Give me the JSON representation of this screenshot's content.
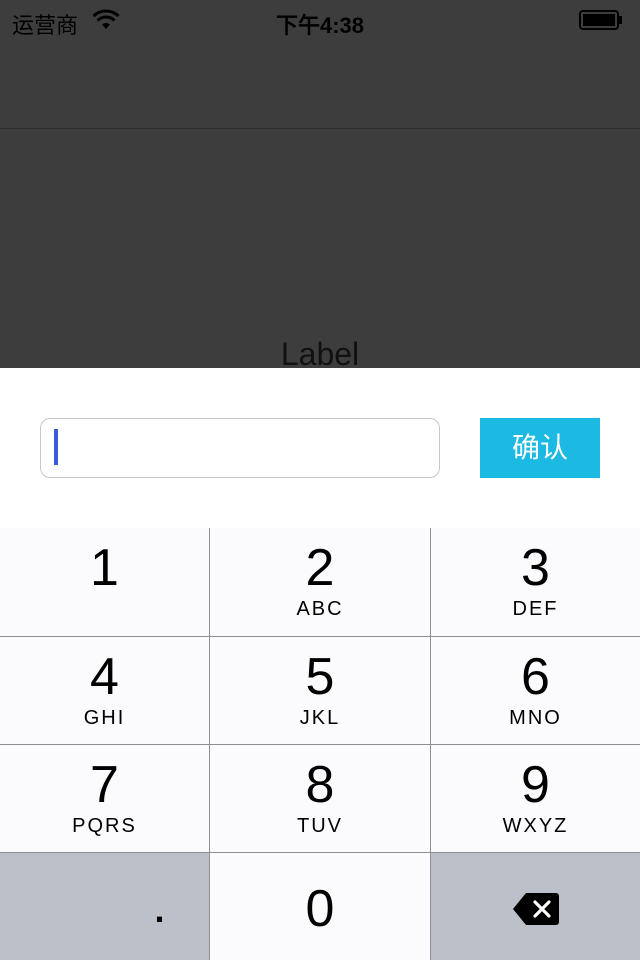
{
  "status_bar": {
    "carrier": "运营商",
    "time": "下午4:38",
    "wifi_icon": "wifi-icon",
    "battery_icon": "battery-icon"
  },
  "main": {
    "label": "Label"
  },
  "input": {
    "value": "",
    "confirm_label": "确认"
  },
  "keypad": {
    "keys": [
      {
        "digit": "1",
        "letters": ""
      },
      {
        "digit": "2",
        "letters": "ABC"
      },
      {
        "digit": "3",
        "letters": "DEF"
      },
      {
        "digit": "4",
        "letters": "GHI"
      },
      {
        "digit": "5",
        "letters": "JKL"
      },
      {
        "digit": "6",
        "letters": "MNO"
      },
      {
        "digit": "7",
        "letters": "PQRS"
      },
      {
        "digit": "8",
        "letters": "TUV"
      },
      {
        "digit": "9",
        "letters": "WXYZ"
      }
    ],
    "decimal_label": ".",
    "zero_label": "0",
    "delete_icon": "backspace-icon"
  },
  "colors": {
    "background": "#3d3d3d",
    "accent": "#1cb9e3",
    "caret": "#3b5bdb",
    "key_light": "#fbfbfd",
    "key_dark": "#bcc0c8"
  }
}
